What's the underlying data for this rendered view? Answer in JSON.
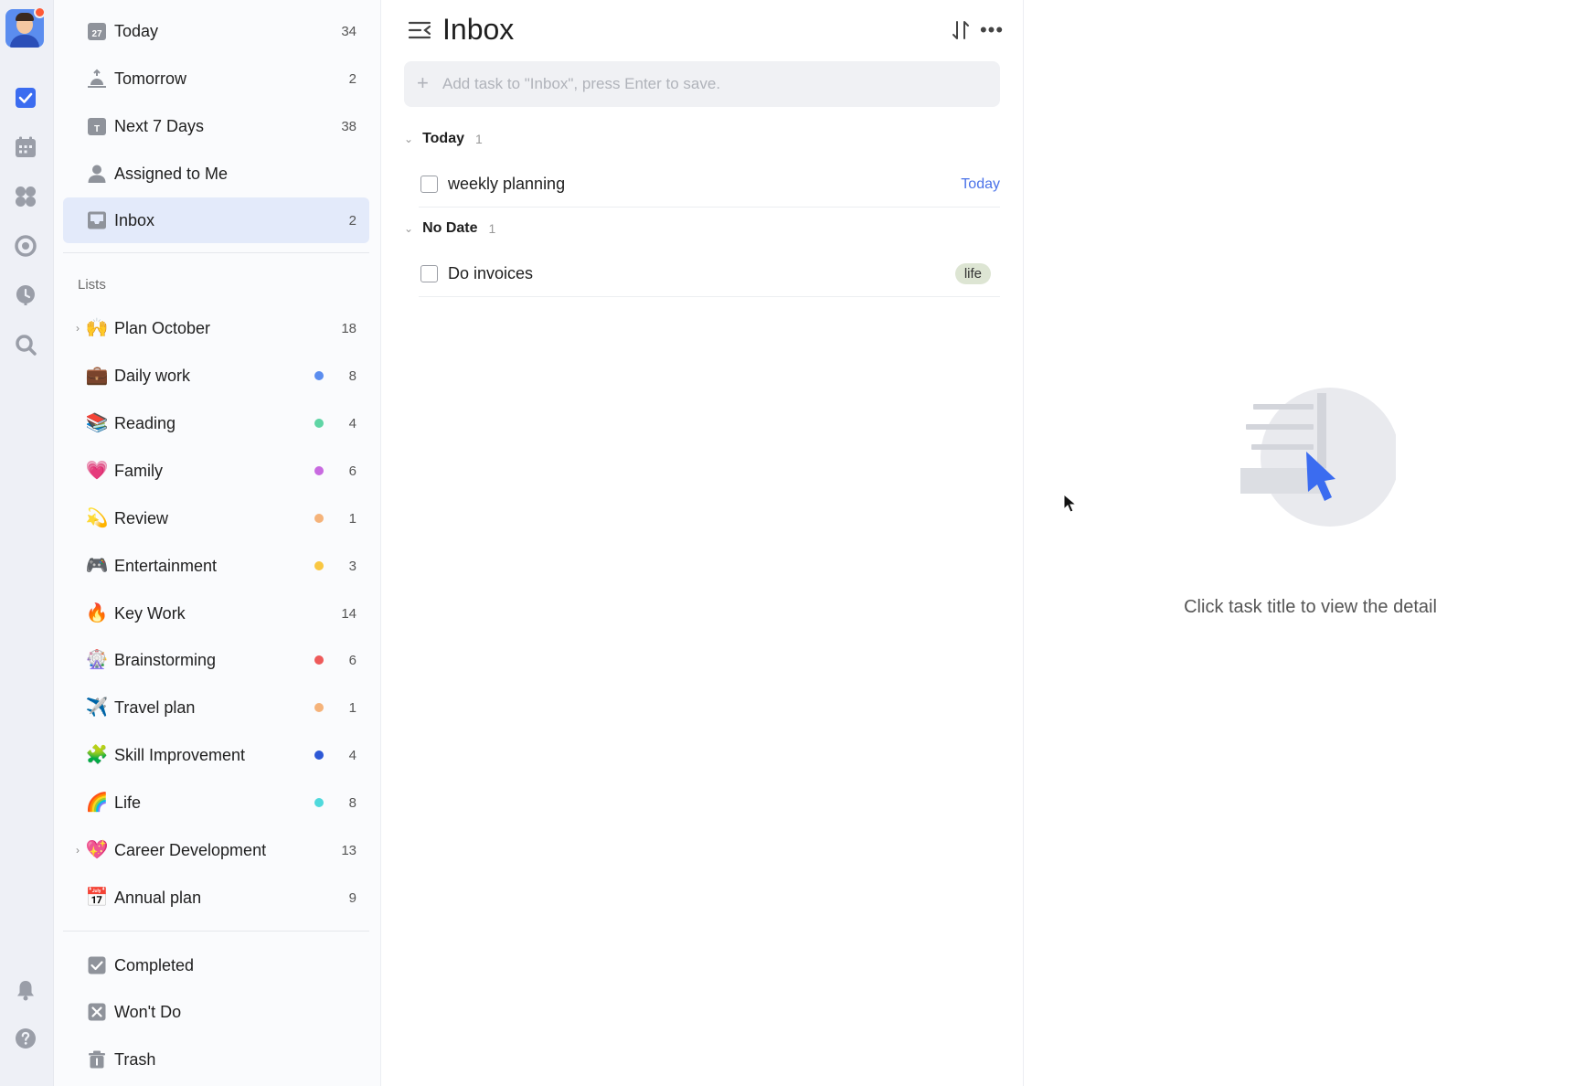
{
  "rail": {
    "icons": [
      "task-check-icon",
      "calendar-icon",
      "matrix-icon",
      "pomodoro-icon",
      "habit-icon",
      "search-icon",
      "bell-icon",
      "help-icon"
    ]
  },
  "smart_lists": [
    {
      "label": "Today",
      "count": "34",
      "icon": "calendar-today-icon",
      "icon_text": "27"
    },
    {
      "label": "Tomorrow",
      "count": "2",
      "icon": "sunrise-icon"
    },
    {
      "label": "Next 7 Days",
      "count": "38",
      "icon": "calendar-week-icon",
      "icon_text": "T"
    },
    {
      "label": "Assigned to Me",
      "count": "",
      "icon": "person-icon"
    },
    {
      "label": "Inbox",
      "count": "2",
      "icon": "inbox-icon",
      "active": true
    }
  ],
  "lists_heading": "Lists",
  "lists": [
    {
      "label": "Plan October",
      "emoji": "🙌",
      "count": "18",
      "color": "",
      "caret": "›"
    },
    {
      "label": "Daily work",
      "emoji": "💼",
      "count": "8",
      "color": "#5b8def"
    },
    {
      "label": "Reading",
      "emoji": "📚",
      "count": "4",
      "color": "#5fd5a5"
    },
    {
      "label": "Family",
      "emoji": "💗",
      "count": "6",
      "color": "#c86ae0"
    },
    {
      "label": "Review",
      "emoji": "💫",
      "count": "1",
      "color": "#f5b37a"
    },
    {
      "label": "Entertainment",
      "emoji": "🎮",
      "count": "3",
      "color": "#f9c742"
    },
    {
      "label": "Key Work",
      "emoji": "🔥",
      "count": "14",
      "color": ""
    },
    {
      "label": "Brainstorming",
      "emoji": "🎡",
      "count": "6",
      "color": "#ee5a5a"
    },
    {
      "label": "Travel plan",
      "emoji": "✈️",
      "count": "1",
      "color": "#f5b37a"
    },
    {
      "label": "Skill Improvement",
      "emoji": "🧩",
      "count": "4",
      "color": "#2d58d6"
    },
    {
      "label": "Life",
      "emoji": "🌈",
      "count": "8",
      "color": "#4fd9dc"
    },
    {
      "label": "Career Development",
      "emoji": "💖",
      "count": "13",
      "color": "",
      "caret": "›"
    },
    {
      "label": "Annual plan",
      "emoji": "📅",
      "count": "9",
      "color": ""
    }
  ],
  "bottom_lists": [
    {
      "label": "Completed",
      "icon": "completed-icon"
    },
    {
      "label": "Won't Do",
      "icon": "wont-do-icon"
    },
    {
      "label": "Trash",
      "icon": "trash-icon"
    }
  ],
  "taskpane": {
    "title": "Inbox",
    "add_placeholder": "Add task to \"Inbox\", press Enter to save.",
    "sections": [
      {
        "name": "Today",
        "count": "1",
        "tasks": [
          {
            "title": "weekly planning",
            "date": "Today",
            "tag": ""
          }
        ]
      },
      {
        "name": "No Date",
        "count": "1",
        "tasks": [
          {
            "title": "Do invoices",
            "date": "",
            "tag": "life"
          }
        ]
      }
    ]
  },
  "detail": {
    "hint": "Click task title to view the detail"
  },
  "colors": {
    "accent": "#4a72e8",
    "active_bg": "#e3eafa",
    "tag_bg": "#dde5d3"
  }
}
